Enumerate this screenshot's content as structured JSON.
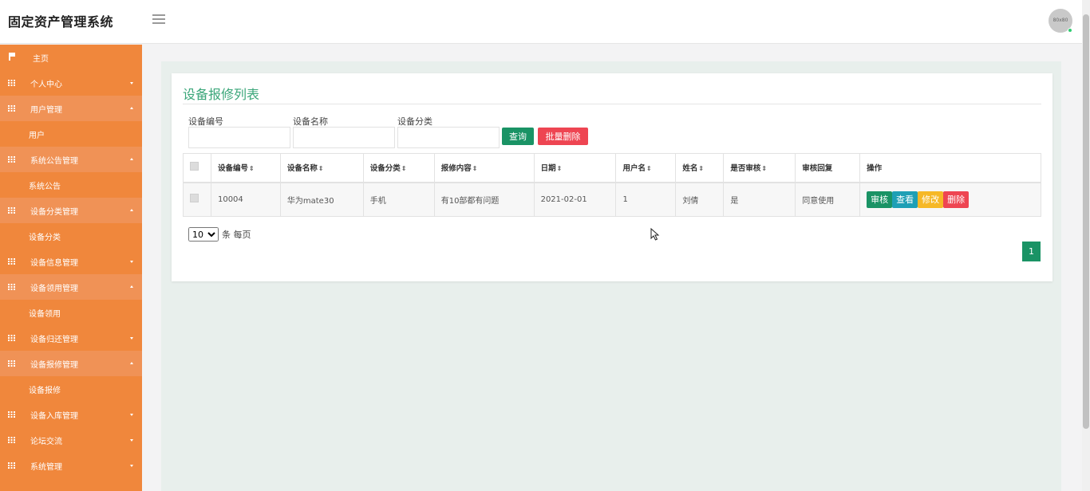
{
  "app": {
    "title": "固定资产管理系统",
    "avatar_text": "80x80"
  },
  "sidebar": {
    "items": [
      {
        "label": "主页",
        "type": "home"
      },
      {
        "label": "个人中心",
        "type": "parent",
        "open": false
      },
      {
        "label": "用户管理",
        "type": "parent",
        "open": true
      },
      {
        "label": "用户",
        "type": "child"
      },
      {
        "label": "系统公告管理",
        "type": "parent",
        "open": true
      },
      {
        "label": "系统公告",
        "type": "child"
      },
      {
        "label": "设备分类管理",
        "type": "parent",
        "open": true
      },
      {
        "label": "设备分类",
        "type": "child"
      },
      {
        "label": "设备信息管理",
        "type": "parent",
        "open": false
      },
      {
        "label": "设备领用管理",
        "type": "parent",
        "open": true
      },
      {
        "label": "设备领用",
        "type": "child"
      },
      {
        "label": "设备归还管理",
        "type": "parent",
        "open": false
      },
      {
        "label": "设备报修管理",
        "type": "parent",
        "open": true
      },
      {
        "label": "设备报修",
        "type": "child"
      },
      {
        "label": "设备入库管理",
        "type": "parent",
        "open": false
      },
      {
        "label": "论坛交流",
        "type": "parent",
        "open": false
      },
      {
        "label": "系统管理",
        "type": "parent",
        "open": false
      }
    ]
  },
  "main": {
    "title": "设备报修列表",
    "filters": {
      "code_label": "设备编号",
      "name_label": "设备名称",
      "category_label": "设备分类",
      "code_value": "",
      "name_value": "",
      "category_value": ""
    },
    "buttons": {
      "query": "查询",
      "batch_delete": "批量删除"
    },
    "table": {
      "headers": [
        "设备编号",
        "设备名称",
        "设备分类",
        "报修内容",
        "日期",
        "用户名",
        "姓名",
        "是否审核",
        "审核回复",
        "操作"
      ],
      "rows": [
        {
          "code": "10004",
          "name": "华为mate30",
          "category": "手机",
          "content": "有10部都有问题",
          "date": "2021-02-01",
          "username": "1",
          "realname": "刘倩",
          "approved": "是",
          "reply": "同意使用"
        }
      ],
      "actions": {
        "approve": "审核",
        "view": "查看",
        "edit": "修改",
        "delete": "删除"
      }
    },
    "pager": {
      "page_size": "10",
      "per_page_label": "条 每页",
      "current_page": "1"
    }
  },
  "colors": {
    "sidebar": "#f0873c",
    "primary": "#1a9365",
    "danger": "#ee4552",
    "info": "#1e9fb5",
    "warning": "#f6b826",
    "title": "#3aa679"
  }
}
